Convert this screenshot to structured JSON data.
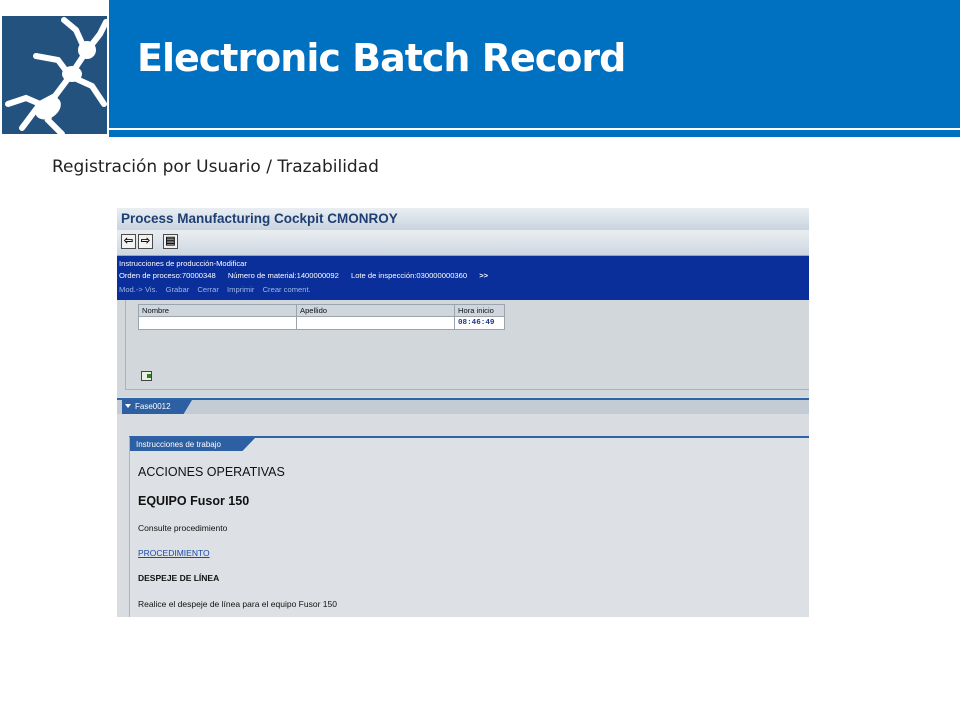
{
  "slide": {
    "title": "Electronic Batch Record",
    "subtitle": "Registración por Usuario / Trazabilidad"
  },
  "sap": {
    "window_title": "Process Manufacturing Cockpit CMONROY",
    "toolbar": {
      "back_icon": "arrow-left-icon",
      "forward_icon": "arrow-right-icon",
      "save_icon": "document-icon"
    },
    "header": {
      "mode": "Instrucciones de producción-Modificar",
      "order": "Orden de proceso:70000348",
      "material": "Número de material:1400000092",
      "lot": "Lote de inspección:030000000360",
      "more": ">>",
      "links": [
        "Mod.-> Vis.",
        "Grabar",
        "Cerrar",
        "Imprimir",
        "Crear coment."
      ]
    },
    "grid": {
      "columns": [
        "Nombre",
        "Apellido",
        "Hora inicio"
      ],
      "rows": [
        [
          "",
          "",
          "08:46:49"
        ]
      ]
    },
    "phase_tab": "Fase0012",
    "instructions_tab": "Instrucciones de trabajo",
    "content": {
      "heading": "ACCIONES OPERATIVAS",
      "equipment": "EQUIPO Fusor 150",
      "consult": "Consulte procedimiento",
      "link": "PROCEDIMIENTO",
      "section": "DESPEJE DE LÍNEA",
      "instruction": "Realice el despeje de línea para el equipo Fusor 150"
    }
  },
  "colors": {
    "header_blue": "#0070c0",
    "sap_blue": "#0a2e9a"
  }
}
